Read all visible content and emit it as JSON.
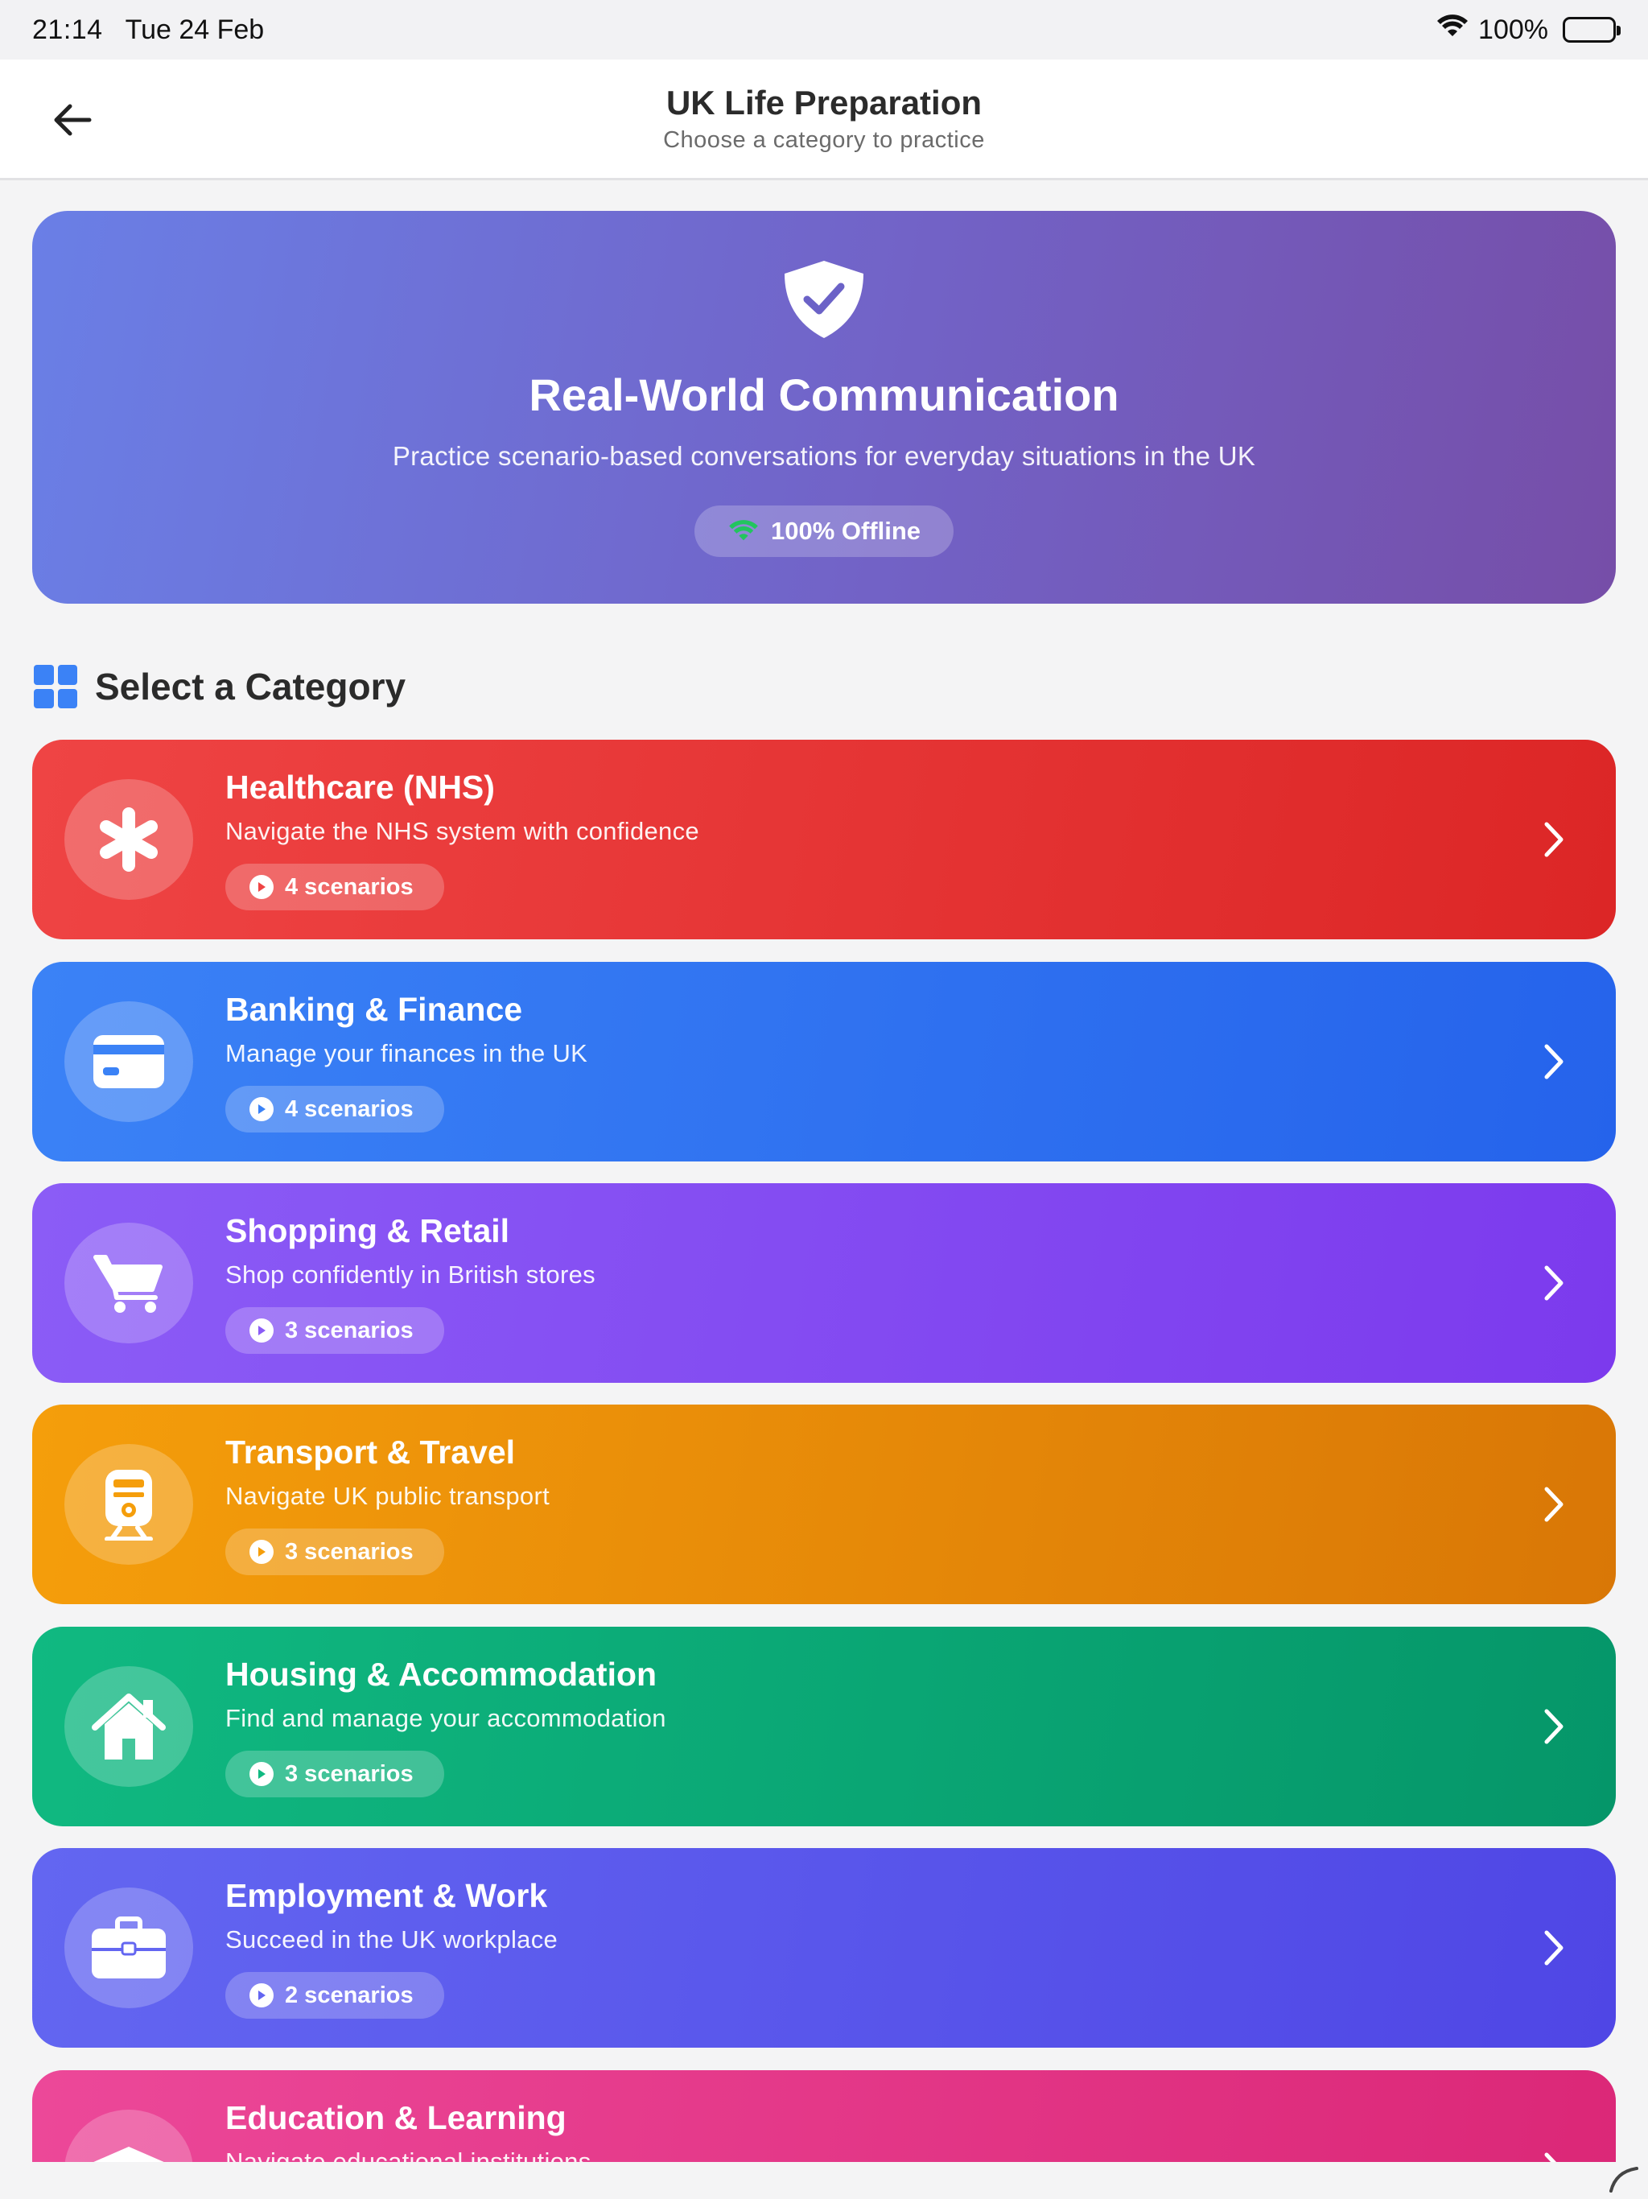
{
  "status_bar": {
    "time": "21:14",
    "date": "Tue 24 Feb",
    "battery": "100%"
  },
  "nav": {
    "title": "UK Life Preparation",
    "subtitle": "Choose a category to practice"
  },
  "hero": {
    "title": "Real-World Communication",
    "subtitle": "Practice scenario-based conversations for everyday situations in the UK",
    "badge": "100% Offline",
    "icon": "shield-check-icon"
  },
  "section": {
    "title": "Select a Category",
    "icon": "grid-icon"
  },
  "categories": [
    {
      "title": "Healthcare (NHS)",
      "description": "Navigate the NHS system with confidence",
      "count": "4 scenarios",
      "icon": "medical-asterisk-icon",
      "color": "#ef4444"
    },
    {
      "title": "Banking & Finance",
      "description": "Manage your finances in the UK",
      "count": "4 scenarios",
      "icon": "credit-card-icon",
      "color": "#3b82f6"
    },
    {
      "title": "Shopping & Retail",
      "description": "Shop confidently in British stores",
      "count": "3 scenarios",
      "icon": "shopping-cart-icon",
      "color": "#8b5cf6"
    },
    {
      "title": "Transport & Travel",
      "description": "Navigate UK public transport",
      "count": "3 scenarios",
      "icon": "train-icon",
      "color": "#f59e0b"
    },
    {
      "title": "Housing & Accommodation",
      "description": "Find and manage your accommodation",
      "count": "3 scenarios",
      "icon": "house-icon",
      "color": "#10b981"
    },
    {
      "title": "Employment & Work",
      "description": "Succeed in the UK workplace",
      "count": "2 scenarios",
      "icon": "briefcase-icon",
      "color": "#6366f1"
    },
    {
      "title": "Education & Learning",
      "description": "Navigate educational institutions",
      "count": "",
      "icon": "graduation-cap-icon",
      "color": "#ec4899"
    }
  ]
}
